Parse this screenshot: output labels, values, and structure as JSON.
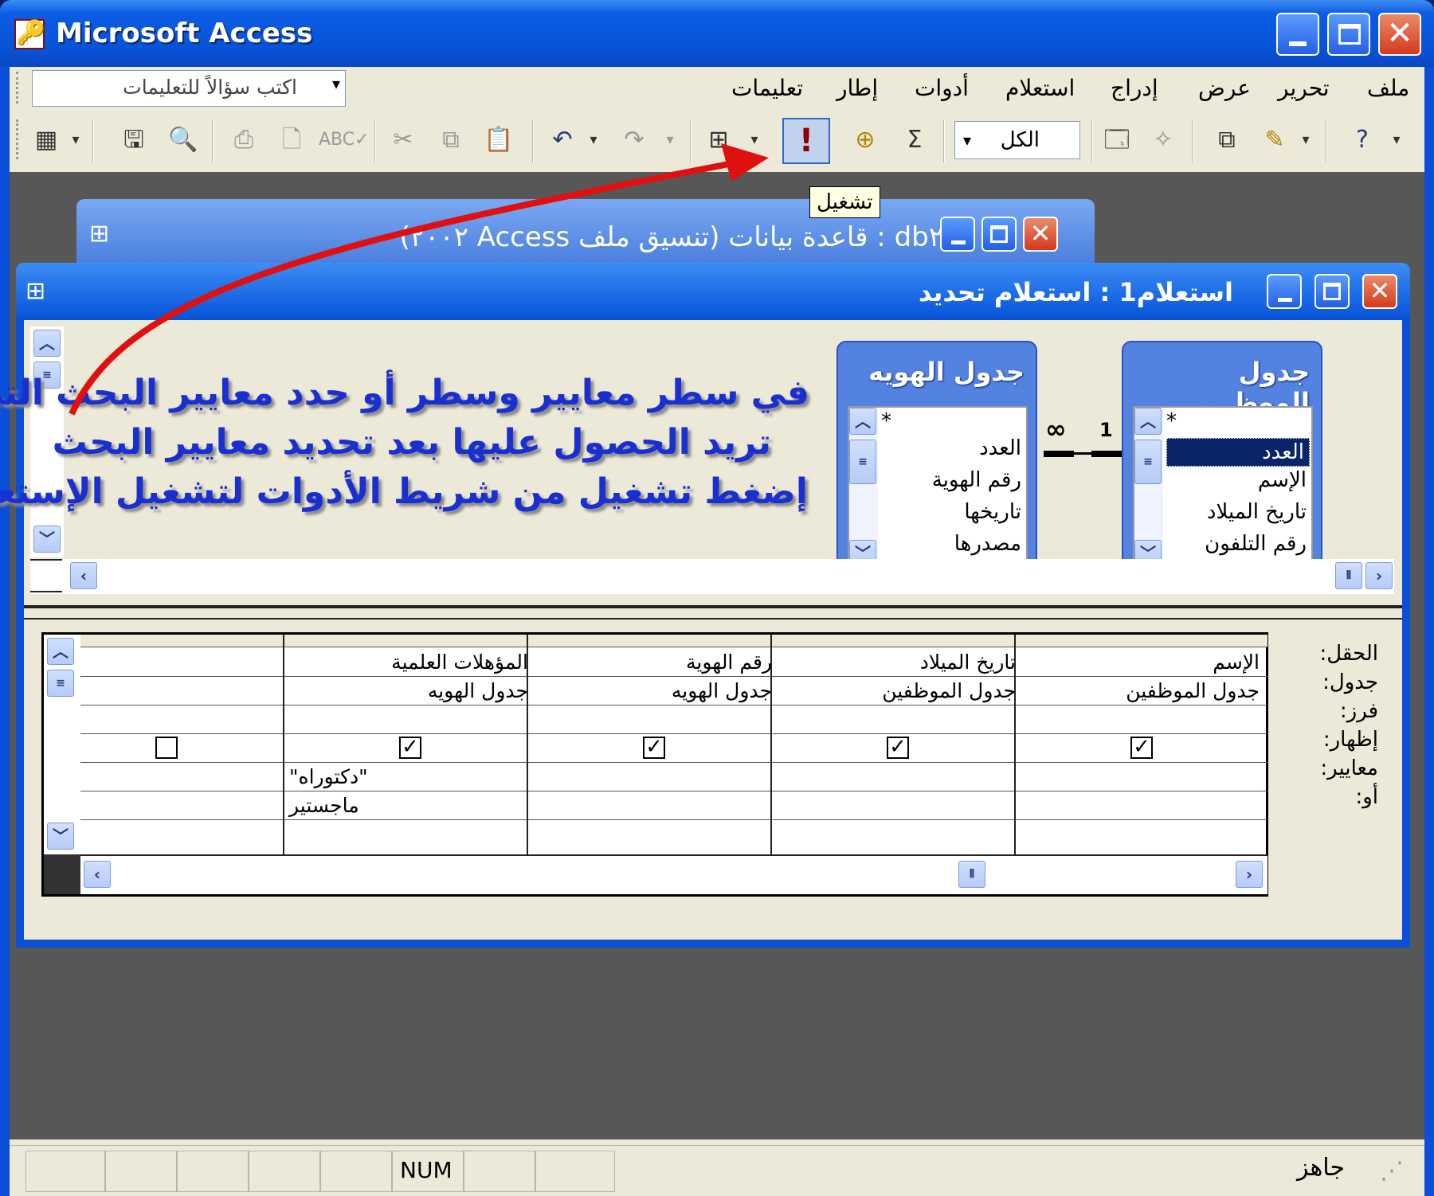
{
  "app": {
    "title": "Microsoft Access",
    "status": {
      "ready": "جاهز",
      "num": "NUM"
    }
  },
  "menu": {
    "items": [
      "ملف",
      "تحرير",
      "عرض",
      "إدراج",
      "استعلام",
      "أدوات",
      "إطار",
      "تعليمات"
    ],
    "ask_placeholder": "اكتب سؤالاً للتعليمات"
  },
  "toolbar": {
    "all_combo": "الكل",
    "run_tooltip": "تشغيل",
    "icons": [
      "view-icon",
      "save-icon",
      "search-icon",
      "print-icon",
      "print-preview-icon",
      "spelling-icon",
      "cut-icon",
      "copy-icon",
      "paste-icon",
      "undo-icon",
      "redo-icon",
      "query-type-icon",
      "run-icon",
      "show-table-icon",
      "totals-icon",
      "properties-icon",
      "build-icon",
      "database-window-icon",
      "new-object-icon",
      "help-icon"
    ]
  },
  "db_window": {
    "title": "db٢ : قاعدة بيانات (تنسيق ملف Access ٢٠٠٢)"
  },
  "query_window": {
    "title": "استعلام1 : استعلام تحديد",
    "tables": [
      {
        "title": "جدول الموظ...",
        "fields": [
          "*",
          "العدد",
          "الإسم",
          "تاريخ الميلاد",
          "رقم التلفون"
        ],
        "selected": "العدد"
      },
      {
        "title": "جدول الهويه",
        "fields": [
          "*",
          "العدد",
          "رقم الهوية",
          "تاريخها",
          "مصدرها"
        ]
      }
    ],
    "relationship": {
      "one": "1",
      "many": "∞"
    },
    "annotation": [
      "في سطر معايير وسطر أو حدد معايير البحث التي",
      "تريد الحصول عليها بعد تحديد معايير البحث",
      "إضغط تشغيل من شريط الأدوات لتشغيل الإستعلام"
    ],
    "grid": {
      "row_labels": [
        "الحقل:",
        "جدول:",
        "فرز:",
        "إظهار:",
        "معايير:",
        "أو:"
      ],
      "columns": [
        {
          "field": "الإسم",
          "table": "جدول الموظفين",
          "show": true,
          "criteria": "",
          "or": ""
        },
        {
          "field": "تاريخ الميلاد",
          "table": "جدول الموظفين",
          "show": true,
          "criteria": "",
          "or": ""
        },
        {
          "field": "رقم الهوية",
          "table": "جدول الهويه",
          "show": true,
          "criteria": "",
          "or": ""
        },
        {
          "field": "المؤهلات العلمية",
          "table": "جدول الهويه",
          "show": true,
          "criteria": "\"دكتوراه\"",
          "or": "ماجستير"
        },
        {
          "field": "",
          "table": "",
          "show": false,
          "criteria": "",
          "or": ""
        }
      ]
    }
  },
  "colors": {
    "title_bar": "#0754d8",
    "annotation": "#1a2fd0",
    "arrow": "#e01010",
    "mdi": "#575757"
  }
}
